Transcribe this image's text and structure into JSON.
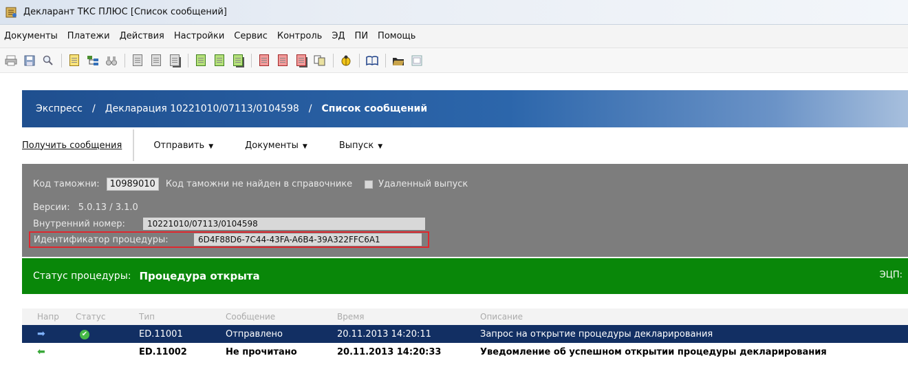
{
  "window": {
    "title": "Декларант ТКС ПЛЮС [Список сообщений]"
  },
  "menu": [
    "Документы",
    "Платежи",
    "Действия",
    "Настройки",
    "Сервис",
    "Контроль",
    "ЭД",
    "ПИ",
    "Помощь"
  ],
  "toolbar": {
    "icons": [
      "print-icon",
      "save-icon",
      "zoom-icon",
      "new-doc-icon",
      "tree-icon",
      "binoculars-icon",
      "doc-icon",
      "doc-icon",
      "docs-icon",
      "green-doc-icon",
      "green-doc-icon",
      "green-docs-icon",
      "red-doc-icon",
      "red-doc-icon",
      "red-docs-icon",
      "copy-icon",
      "scarab-icon",
      "book-icon",
      "folder-icon",
      "window-icon"
    ]
  },
  "breadcrumb": {
    "items": [
      "Экспресс",
      "Декларация  10221010/07113/0104598"
    ],
    "separator": "/",
    "current": "Список сообщений"
  },
  "actions": {
    "get_messages": "Получить сообщения",
    "send": "Отправить",
    "documents": "Документы",
    "release": "Выпуск"
  },
  "info": {
    "customs_code_label": "Код таможни:",
    "customs_code_value": "10989010",
    "customs_code_note": "Код таможни не найден в справочнике",
    "remote_release_label": "Удаленный выпуск",
    "versions_label": "Версии:",
    "versions_value": "5.0.13  /  3.1.0",
    "internal_number_label": "Внутренний номер:",
    "internal_number_value": "10221010/07113/0104598",
    "procedure_id_label": "Идентификатор процедуры:",
    "procedure_id_value": "6D4F88D6-7C44-43FA-A6B4-39A322FFC6A1"
  },
  "status": {
    "label": "Статус процедуры:",
    "value": "Процедура открыта",
    "ecp_label": "ЭЦП:"
  },
  "table": {
    "headers": [
      "Напр",
      "Статус",
      "Тип",
      "Сообщение",
      "Время",
      "Описание"
    ],
    "rows": [
      {
        "type": "ED.11001",
        "message": "Отправлено",
        "time": "20.11.2013 14:20:11",
        "description": "Запрос на открытие процедуры декларирования"
      },
      {
        "type": "ED.11002",
        "message": "Не прочитано",
        "time": "20.11.2013 14:20:33",
        "description": "Уведомление об успешном открытии процедуры декларирования"
      }
    ]
  },
  "colors": {
    "header_blue": "#1f4f8f",
    "status_green": "#098709",
    "selected_row": "#122f63",
    "highlight_red": "#e0272e"
  }
}
